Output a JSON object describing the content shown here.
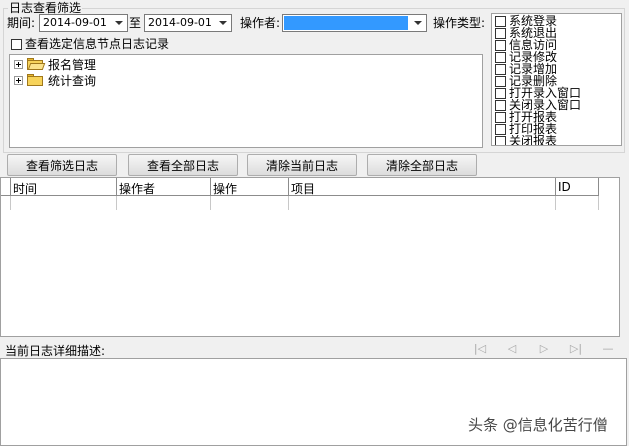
{
  "filter": {
    "group_title": "日志查看筛选",
    "period_label": "期间:",
    "start_date": "2014-09-01",
    "to_label": "至",
    "end_date": "2014-09-01",
    "operator_label": "操作者:",
    "optype_label": "操作类型:",
    "node_checkbox_label": "查看选定信息节点日志记录"
  },
  "tree": {
    "items": [
      {
        "label": "报名管理"
      },
      {
        "label": "统计查询"
      }
    ]
  },
  "operation_types": [
    "系统登录",
    "系统退出",
    "信息访问",
    "记录修改",
    "记录增加",
    "记录删除",
    "打开录入窗口",
    "关闭录入窗口",
    "打开报表",
    "打印报表",
    "关闭报表"
  ],
  "buttons": {
    "view_filtered": "查看筛选日志",
    "view_all": "查看全部日志",
    "clear_current": "清除当前日志",
    "clear_all": "清除全部日志"
  },
  "grid": {
    "columns": [
      "时间",
      "操作者",
      "操作",
      "项目",
      "ID"
    ]
  },
  "detail": {
    "label": "当前日志详细描述:"
  },
  "watermark": "头条 @信息化苦行僧",
  "colors": {
    "selection": "#3399ff",
    "background": "#f0f0f0"
  }
}
